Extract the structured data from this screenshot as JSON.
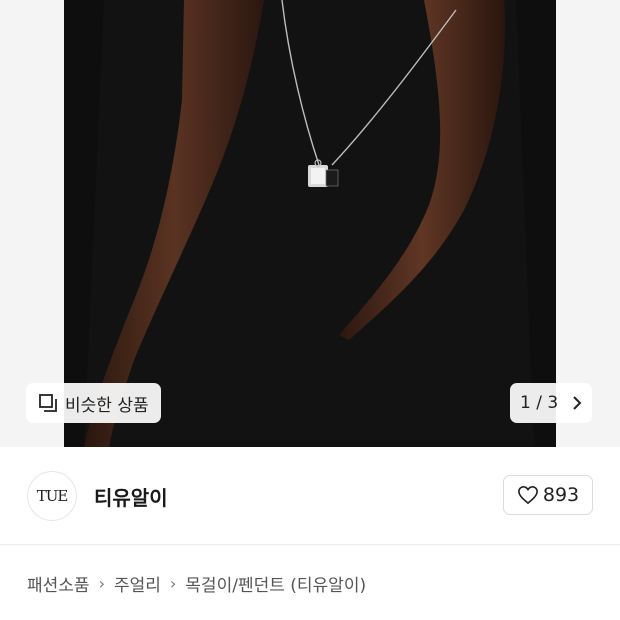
{
  "product_image": {
    "similar_button_label": "비슷한 상품",
    "counter": "1 / 3"
  },
  "seller": {
    "logo_text": "TUE",
    "name": "티유알이",
    "like_count": "893"
  },
  "breadcrumb": {
    "items": [
      "패션소품",
      "주얼리",
      "목걸이/펜던트 (티유알이)"
    ]
  },
  "colors": {
    "sweater": "#0e0e0f",
    "hair": "#4a2a1c",
    "background": "#ffffff"
  }
}
